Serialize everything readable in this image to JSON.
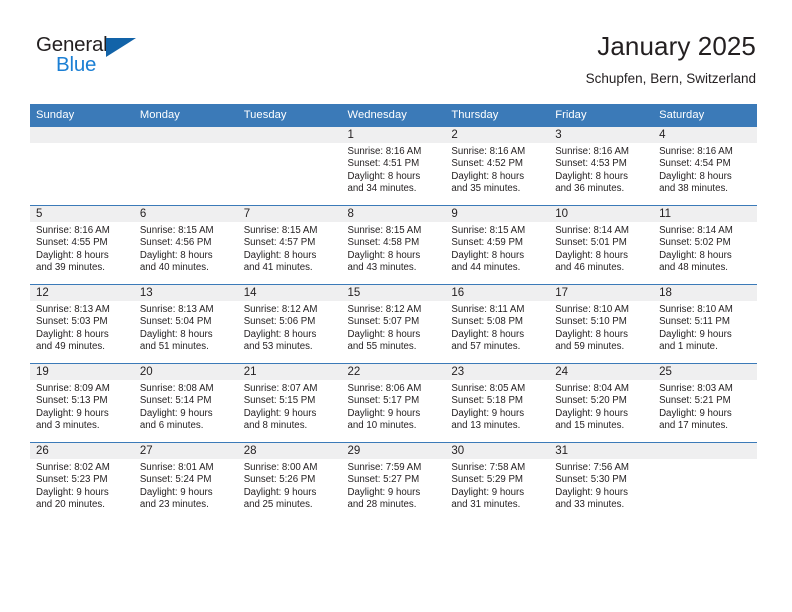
{
  "brand": {
    "name_part1": "General",
    "name_part2": "Blue",
    "accent_color": "#1b7fd4",
    "triangle_color": "#1263a8"
  },
  "header": {
    "title": "January 2025",
    "location": "Schupfen, Bern, Switzerland"
  },
  "theme": {
    "header_row_color": "#3b7ab8",
    "daynum_band_color": "#efeff0",
    "text_color": "#231f20"
  },
  "weekday_headers": [
    "Sunday",
    "Monday",
    "Tuesday",
    "Wednesday",
    "Thursday",
    "Friday",
    "Saturday"
  ],
  "weeks": [
    [
      {
        "day": "",
        "sunrise": "",
        "sunset": "",
        "daylight_line1": "",
        "daylight_line2": ""
      },
      {
        "day": "",
        "sunrise": "",
        "sunset": "",
        "daylight_line1": "",
        "daylight_line2": ""
      },
      {
        "day": "",
        "sunrise": "",
        "sunset": "",
        "daylight_line1": "",
        "daylight_line2": ""
      },
      {
        "day": "1",
        "sunrise": "Sunrise: 8:16 AM",
        "sunset": "Sunset: 4:51 PM",
        "daylight_line1": "Daylight: 8 hours",
        "daylight_line2": "and 34 minutes."
      },
      {
        "day": "2",
        "sunrise": "Sunrise: 8:16 AM",
        "sunset": "Sunset: 4:52 PM",
        "daylight_line1": "Daylight: 8 hours",
        "daylight_line2": "and 35 minutes."
      },
      {
        "day": "3",
        "sunrise": "Sunrise: 8:16 AM",
        "sunset": "Sunset: 4:53 PM",
        "daylight_line1": "Daylight: 8 hours",
        "daylight_line2": "and 36 minutes."
      },
      {
        "day": "4",
        "sunrise": "Sunrise: 8:16 AM",
        "sunset": "Sunset: 4:54 PM",
        "daylight_line1": "Daylight: 8 hours",
        "daylight_line2": "and 38 minutes."
      }
    ],
    [
      {
        "day": "5",
        "sunrise": "Sunrise: 8:16 AM",
        "sunset": "Sunset: 4:55 PM",
        "daylight_line1": "Daylight: 8 hours",
        "daylight_line2": "and 39 minutes."
      },
      {
        "day": "6",
        "sunrise": "Sunrise: 8:15 AM",
        "sunset": "Sunset: 4:56 PM",
        "daylight_line1": "Daylight: 8 hours",
        "daylight_line2": "and 40 minutes."
      },
      {
        "day": "7",
        "sunrise": "Sunrise: 8:15 AM",
        "sunset": "Sunset: 4:57 PM",
        "daylight_line1": "Daylight: 8 hours",
        "daylight_line2": "and 41 minutes."
      },
      {
        "day": "8",
        "sunrise": "Sunrise: 8:15 AM",
        "sunset": "Sunset: 4:58 PM",
        "daylight_line1": "Daylight: 8 hours",
        "daylight_line2": "and 43 minutes."
      },
      {
        "day": "9",
        "sunrise": "Sunrise: 8:15 AM",
        "sunset": "Sunset: 4:59 PM",
        "daylight_line1": "Daylight: 8 hours",
        "daylight_line2": "and 44 minutes."
      },
      {
        "day": "10",
        "sunrise": "Sunrise: 8:14 AM",
        "sunset": "Sunset: 5:01 PM",
        "daylight_line1": "Daylight: 8 hours",
        "daylight_line2": "and 46 minutes."
      },
      {
        "day": "11",
        "sunrise": "Sunrise: 8:14 AM",
        "sunset": "Sunset: 5:02 PM",
        "daylight_line1": "Daylight: 8 hours",
        "daylight_line2": "and 48 minutes."
      }
    ],
    [
      {
        "day": "12",
        "sunrise": "Sunrise: 8:13 AM",
        "sunset": "Sunset: 5:03 PM",
        "daylight_line1": "Daylight: 8 hours",
        "daylight_line2": "and 49 minutes."
      },
      {
        "day": "13",
        "sunrise": "Sunrise: 8:13 AM",
        "sunset": "Sunset: 5:04 PM",
        "daylight_line1": "Daylight: 8 hours",
        "daylight_line2": "and 51 minutes."
      },
      {
        "day": "14",
        "sunrise": "Sunrise: 8:12 AM",
        "sunset": "Sunset: 5:06 PM",
        "daylight_line1": "Daylight: 8 hours",
        "daylight_line2": "and 53 minutes."
      },
      {
        "day": "15",
        "sunrise": "Sunrise: 8:12 AM",
        "sunset": "Sunset: 5:07 PM",
        "daylight_line1": "Daylight: 8 hours",
        "daylight_line2": "and 55 minutes."
      },
      {
        "day": "16",
        "sunrise": "Sunrise: 8:11 AM",
        "sunset": "Sunset: 5:08 PM",
        "daylight_line1": "Daylight: 8 hours",
        "daylight_line2": "and 57 minutes."
      },
      {
        "day": "17",
        "sunrise": "Sunrise: 8:10 AM",
        "sunset": "Sunset: 5:10 PM",
        "daylight_line1": "Daylight: 8 hours",
        "daylight_line2": "and 59 minutes."
      },
      {
        "day": "18",
        "sunrise": "Sunrise: 8:10 AM",
        "sunset": "Sunset: 5:11 PM",
        "daylight_line1": "Daylight: 9 hours",
        "daylight_line2": "and 1 minute."
      }
    ],
    [
      {
        "day": "19",
        "sunrise": "Sunrise: 8:09 AM",
        "sunset": "Sunset: 5:13 PM",
        "daylight_line1": "Daylight: 9 hours",
        "daylight_line2": "and 3 minutes."
      },
      {
        "day": "20",
        "sunrise": "Sunrise: 8:08 AM",
        "sunset": "Sunset: 5:14 PM",
        "daylight_line1": "Daylight: 9 hours",
        "daylight_line2": "and 6 minutes."
      },
      {
        "day": "21",
        "sunrise": "Sunrise: 8:07 AM",
        "sunset": "Sunset: 5:15 PM",
        "daylight_line1": "Daylight: 9 hours",
        "daylight_line2": "and 8 minutes."
      },
      {
        "day": "22",
        "sunrise": "Sunrise: 8:06 AM",
        "sunset": "Sunset: 5:17 PM",
        "daylight_line1": "Daylight: 9 hours",
        "daylight_line2": "and 10 minutes."
      },
      {
        "day": "23",
        "sunrise": "Sunrise: 8:05 AM",
        "sunset": "Sunset: 5:18 PM",
        "daylight_line1": "Daylight: 9 hours",
        "daylight_line2": "and 13 minutes."
      },
      {
        "day": "24",
        "sunrise": "Sunrise: 8:04 AM",
        "sunset": "Sunset: 5:20 PM",
        "daylight_line1": "Daylight: 9 hours",
        "daylight_line2": "and 15 minutes."
      },
      {
        "day": "25",
        "sunrise": "Sunrise: 8:03 AM",
        "sunset": "Sunset: 5:21 PM",
        "daylight_line1": "Daylight: 9 hours",
        "daylight_line2": "and 17 minutes."
      }
    ],
    [
      {
        "day": "26",
        "sunrise": "Sunrise: 8:02 AM",
        "sunset": "Sunset: 5:23 PM",
        "daylight_line1": "Daylight: 9 hours",
        "daylight_line2": "and 20 minutes."
      },
      {
        "day": "27",
        "sunrise": "Sunrise: 8:01 AM",
        "sunset": "Sunset: 5:24 PM",
        "daylight_line1": "Daylight: 9 hours",
        "daylight_line2": "and 23 minutes."
      },
      {
        "day": "28",
        "sunrise": "Sunrise: 8:00 AM",
        "sunset": "Sunset: 5:26 PM",
        "daylight_line1": "Daylight: 9 hours",
        "daylight_line2": "and 25 minutes."
      },
      {
        "day": "29",
        "sunrise": "Sunrise: 7:59 AM",
        "sunset": "Sunset: 5:27 PM",
        "daylight_line1": "Daylight: 9 hours",
        "daylight_line2": "and 28 minutes."
      },
      {
        "day": "30",
        "sunrise": "Sunrise: 7:58 AM",
        "sunset": "Sunset: 5:29 PM",
        "daylight_line1": "Daylight: 9 hours",
        "daylight_line2": "and 31 minutes."
      },
      {
        "day": "31",
        "sunrise": "Sunrise: 7:56 AM",
        "sunset": "Sunset: 5:30 PM",
        "daylight_line1": "Daylight: 9 hours",
        "daylight_line2": "and 33 minutes."
      },
      {
        "day": "",
        "sunrise": "",
        "sunset": "",
        "daylight_line1": "",
        "daylight_line2": ""
      }
    ]
  ]
}
